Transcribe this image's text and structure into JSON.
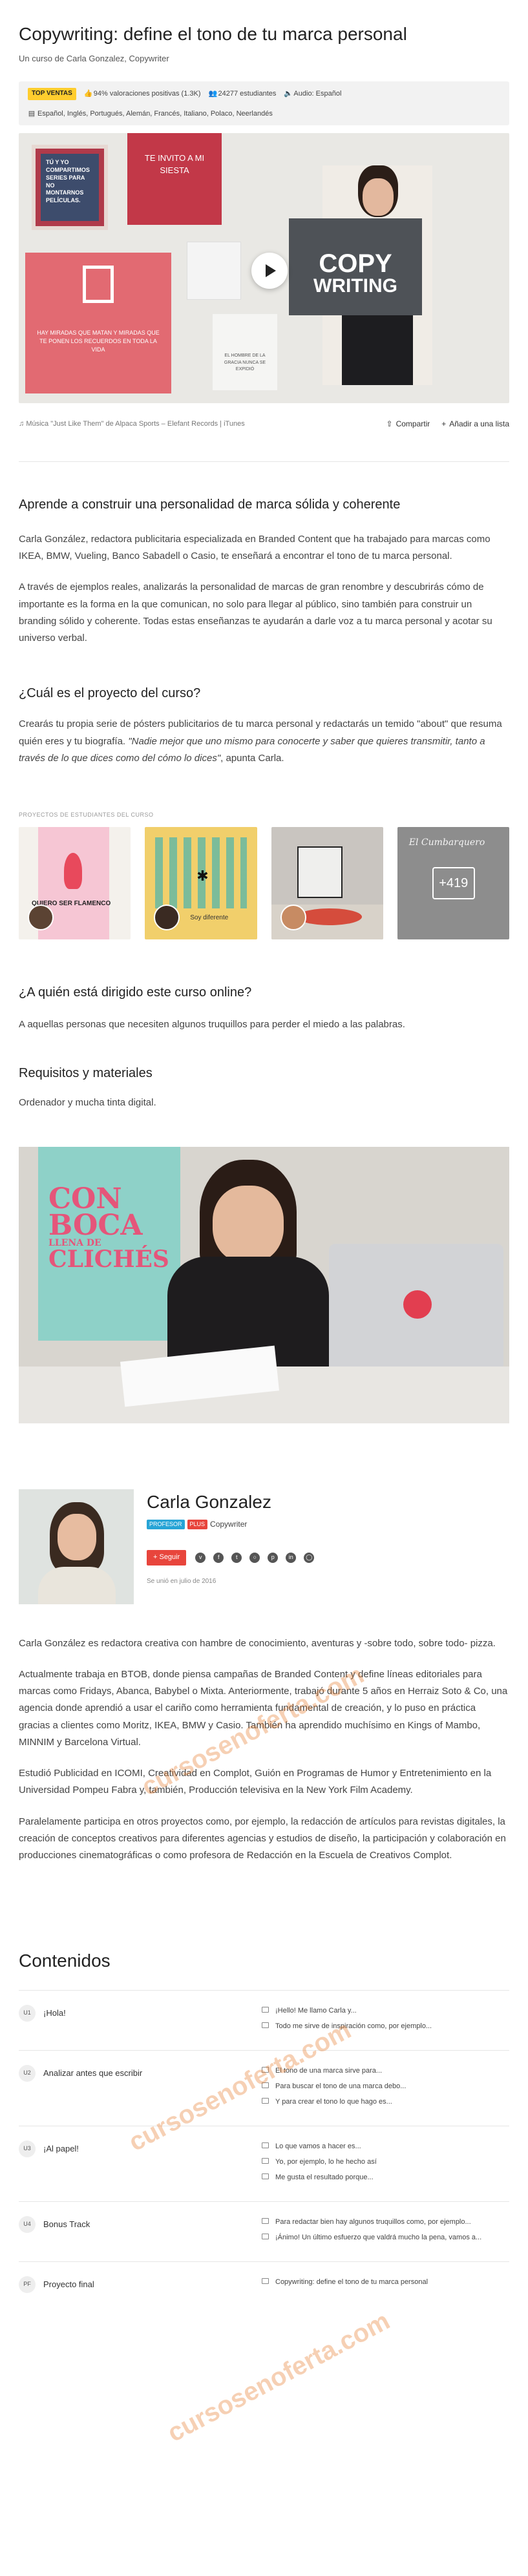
{
  "course": {
    "title": "Copywriting: define el tono de tu marca personal",
    "subtitle": "Un curso de Carla Gonzalez, Copywriter"
  },
  "meta": {
    "badge": "TOP VENTAS",
    "rating": "94% valoraciones positivas (1.3K)",
    "students": "24277 estudiantes",
    "audio": "Audio: Español",
    "subtitles": "Español, Inglés, Portugués, Alemán, Francés, Italiano, Polaco, Neerlandés"
  },
  "hero": {
    "poster1": "TÚ Y YO COMPARTIMOS SERIES PARA NO MONTARNOS PELÍCULAS.",
    "poster2": "TE INVITO A MI SIESTA",
    "poster3": "HAY MIRADAS QUE MATAN Y MIRADAS QUE TE PONEN LOS RECUERDOS EN TODA LA VIDA",
    "poster4": "EL HOMBRE DE LA GRACIA NUNCA SE EXPIDIÓ",
    "sign_line1": "COPY",
    "sign_line2": "WRITING"
  },
  "music": {
    "credit": "Música \"Just Like Them\" de Alpaca Sports – Elefant Records | iTunes",
    "share": "Compartir",
    "add_list": "Añadir a una lista"
  },
  "learn": {
    "heading": "Aprende a construir una personalidad de marca sólida y coherente",
    "p1": "Carla González, redactora publicitaria especializada en Branded Content que ha trabajado para marcas como IKEA, BMW, Vueling, Banco Sabadell o Casio, te enseñará a encontrar el tono de tu marca personal.",
    "p2": "A través de ejemplos reales, analizarás la personalidad de marcas de gran renombre y descubrirás cómo de importante es la forma en la que comunican, no solo para llegar al público, sino también para construir un branding sólido y coherente. Todas estas enseñanzas te ayudarán a darle voz a tu marca personal y acotar su universo verbal."
  },
  "project": {
    "heading": "¿Cuál es el proyecto del curso?",
    "p1": "Crearás tu propia serie de pósters publicitarios de tu marca personal y redactarás un temido \"about\" que resuma quién eres y tu biografía.",
    "quote": "\"Nadie mejor que uno mismo para conocerte y saber que quieres transmitir, tanto a través de lo que dices como del cómo lo dices\"",
    "attribution": ", apunta Carla.",
    "gallery_label": "PROYECTOS DE ESTUDIANTES DEL CURSO",
    "card1_text": "QUIERO SER FLAMENCO",
    "card2_text": "Soy diferente",
    "card4_script": "El Cumbarquero",
    "more": "+419"
  },
  "who": {
    "heading": "¿A quién está dirigido este curso online?",
    "text": "A aquellas personas que necesiten algunos truquillos para perder el miedo a las palabras."
  },
  "req": {
    "heading": "Requisitos y materiales",
    "text": "Ordenador y mucha tinta digital."
  },
  "photo": {
    "wall_text1": "CON",
    "wall_text2": "BOCA",
    "wall_text3": "LLENA DE",
    "wall_text4": "CLICHÉS"
  },
  "teacher": {
    "name": "Carla Gonzalez",
    "tag1": "PROFESOR",
    "tag2": "PLUS",
    "role": "Copywriter",
    "follow": "+ Seguir",
    "joined": "Se unió en julio de 2016"
  },
  "bio": [
    "Carla González es redactora creativa con hambre de conocimiento, aventuras y -sobre todo, sobre todo- pizza.",
    "Actualmente trabaja en BTOB, donde piensa campañas de Branded Content y define líneas editoriales para marcas como Fridays, Abanca, Babybel o Mixta. Anteriormente, trabajó durante 5 años en Herraiz Soto & Co, una agencia donde aprendió a usar el cariño como herramienta fundamental de creación, y lo puso en práctica gracias a clientes como Moritz, IKEA, BMW y Casio. También ha aprendido muchísimo en Kings of Mambo, MINNIM y Barcelona Virtual.",
    "Estudió Publicidad en ICOMI, Creatividad en Complot, Guión en Programas de Humor y Entretenimiento en la Universidad Pompeu Fabra y, también, Producción televisiva en la New York Film Academy.",
    "Paralelamente participa en otros proyectos como, por ejemplo, la redacción de artículos para revistas digitales, la creación de conceptos creativos para diferentes agencias y estudios de diseño, la participación y colaboración en producciones cinematográficas o como profesora de Redacción en la Escuela de Creativos Complot."
  ],
  "contents": {
    "heading": "Contenidos",
    "units": [
      {
        "badge": "U1",
        "title": "¡Hola!",
        "lessons": [
          "¡Hello! Me llamo Carla y...",
          "Todo me sirve de inspiración como, por ejemplo..."
        ]
      },
      {
        "badge": "U2",
        "title": "Analizar antes que escribir",
        "lessons": [
          "El tono de una marca sirve para...",
          "Para buscar el tono de una marca debo...",
          "Y para crear el tono lo que hago es..."
        ]
      },
      {
        "badge": "U3",
        "title": "¡Al papel!",
        "lessons": [
          "Lo que vamos a hacer es...",
          "Yo, por ejemplo, lo he hecho así",
          "Me gusta el resultado porque..."
        ]
      },
      {
        "badge": "U4",
        "title": "Bonus Track",
        "lessons": [
          "Para redactar bien hay algunos truquillos como, por ejemplo...",
          "¡Ánimo! Un último esfuerzo que valdrá mucho la pena, vamos a..."
        ]
      },
      {
        "badge": "PF",
        "title": "Proyecto final",
        "lessons": [
          "Copywriting: define el tono de tu marca personal"
        ]
      }
    ]
  },
  "watermark": "cursosenoferta.com"
}
